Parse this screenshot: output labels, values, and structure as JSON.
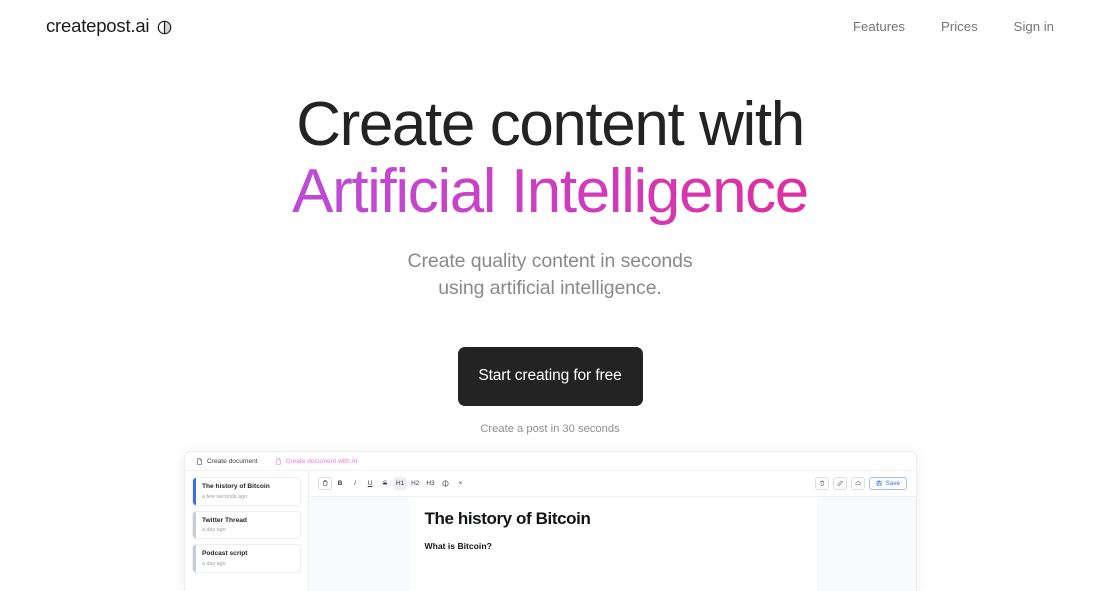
{
  "header": {
    "brand": {
      "name": "createpost.ai",
      "icon": "contrast-circle-icon"
    },
    "nav": [
      {
        "label": "Features"
      },
      {
        "label": "Prices"
      },
      {
        "label": "Sign in"
      }
    ]
  },
  "hero": {
    "headline_line1": "Create content with",
    "headline_line2": "Artificial Intelligence",
    "subhead_line1": "Create quality content in seconds",
    "subhead_line2": "using artificial intelligence.",
    "cta_label": "Start creating for free",
    "cta_note": "Create a post in 30 seconds",
    "gradient_start": "#a855e8",
    "gradient_end": "#e62a7b"
  },
  "app_preview": {
    "topbar": [
      {
        "label": "Create document",
        "icon": "file-icon"
      },
      {
        "label": "Create document with AI",
        "icon": "file-ai-icon"
      }
    ],
    "documents": [
      {
        "title": "The history of Bitcoin",
        "time": "a few seconds ago",
        "active": true
      },
      {
        "title": "Twitter Thread",
        "time": "a day ago",
        "active": false
      },
      {
        "title": "Podcast script",
        "time": "a day ago",
        "active": false
      }
    ],
    "toolbar": [
      {
        "label": "",
        "name": "clipboard-icon",
        "style": "boxed"
      },
      {
        "label": "B",
        "name": "bold-button",
        "style": "bold"
      },
      {
        "label": "I",
        "name": "italic-button",
        "style": "italic"
      },
      {
        "label": "U",
        "name": "underline-button",
        "style": "under"
      },
      {
        "label": "S",
        "name": "strikethrough-button",
        "style": "strike"
      },
      {
        "label": "H1",
        "name": "heading-1-button",
        "style": "on"
      },
      {
        "label": "H2",
        "name": "heading-2-button",
        "style": ""
      },
      {
        "label": "H3",
        "name": "heading-3-button",
        "style": ""
      },
      {
        "label": "",
        "name": "contrast-icon",
        "style": ""
      },
      {
        "label": "×",
        "name": "clear-format-button",
        "style": ""
      }
    ],
    "toolbar_right": {
      "delete_icon": "trash-icon",
      "edit_icon": "pencil-icon",
      "history_icon": "cloud-icon",
      "save_label": "Save",
      "save_icon": "floppy-disk-icon",
      "accent": "#3b6fe0"
    },
    "document": {
      "title": "The history of Bitcoin",
      "heading": "What is Bitcoin?"
    }
  }
}
